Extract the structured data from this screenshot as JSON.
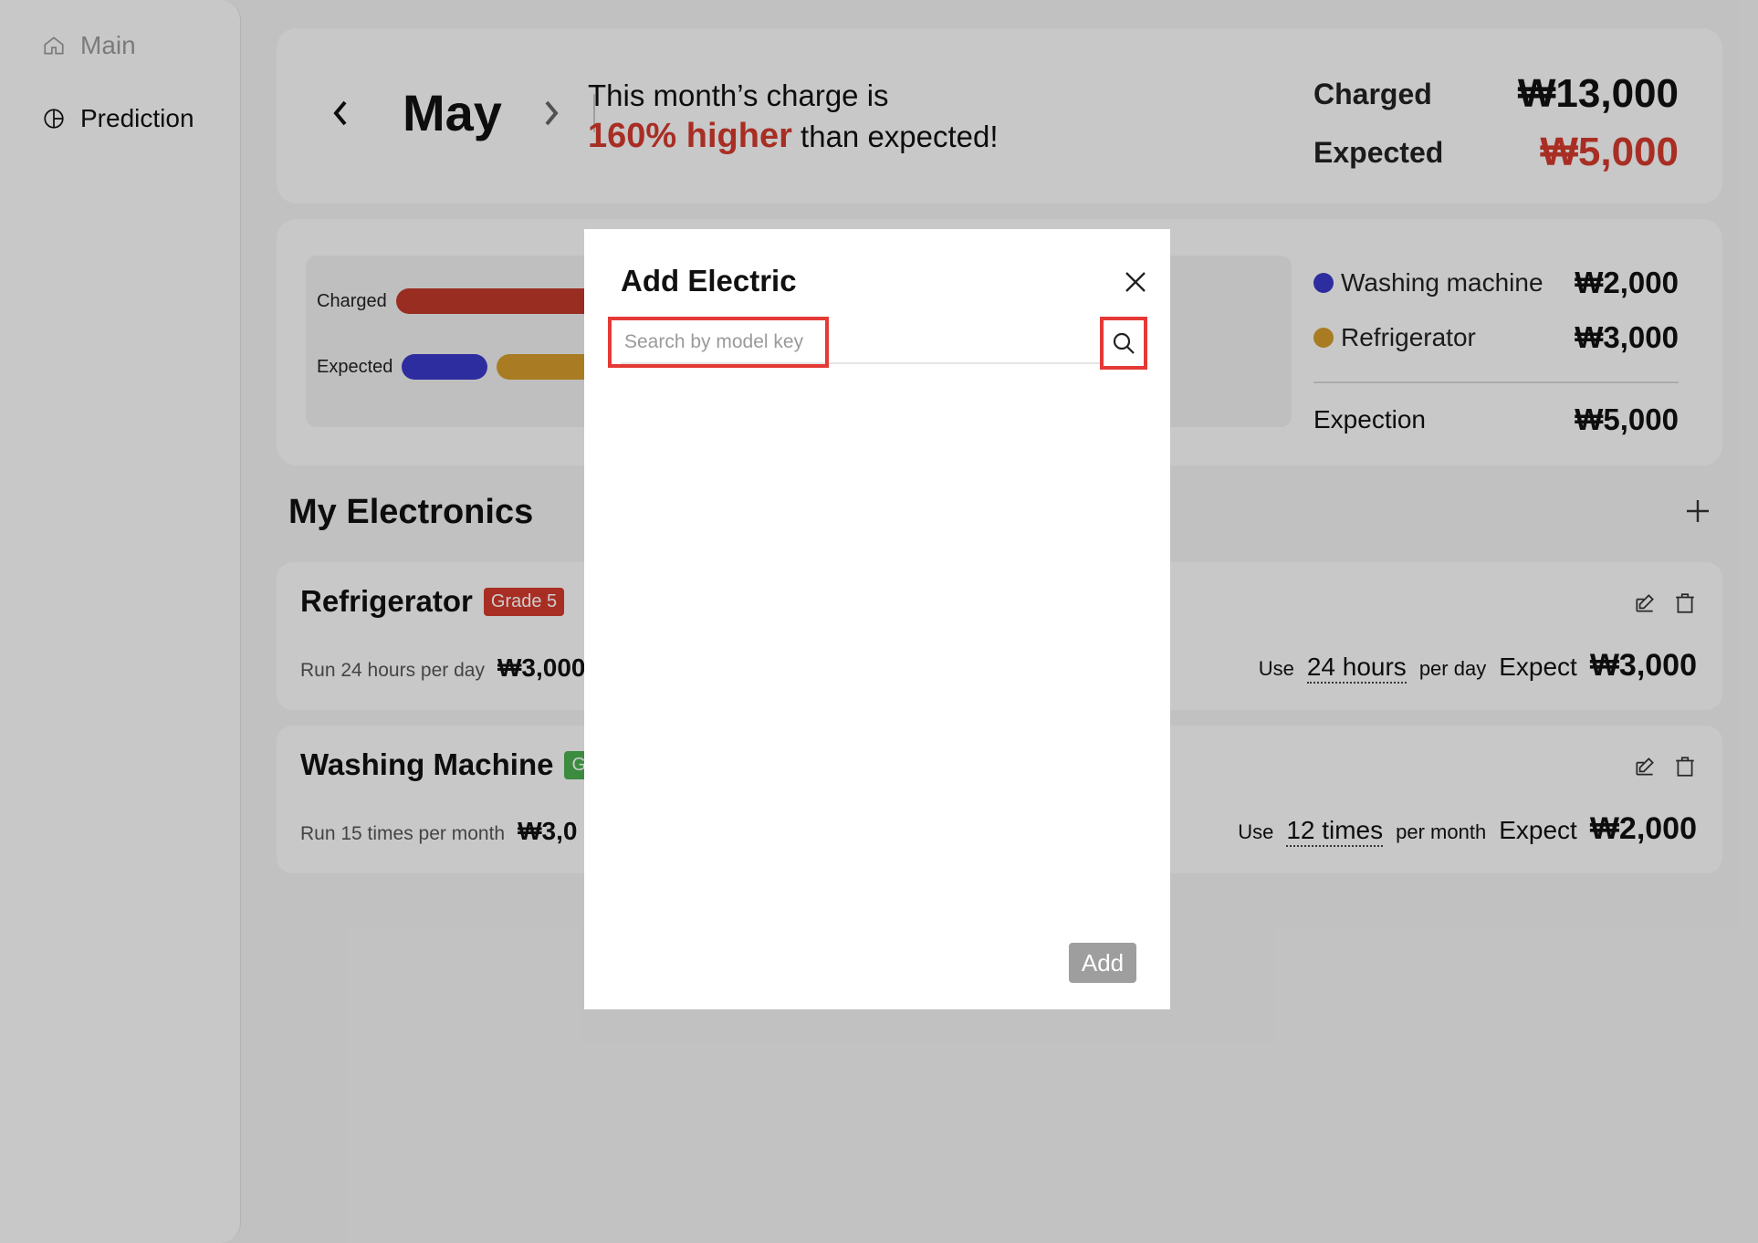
{
  "sidebar": {
    "items": [
      {
        "label": "Main",
        "icon": "home-icon"
      },
      {
        "label": "Prediction",
        "icon": "pie-chart-icon"
      }
    ]
  },
  "header": {
    "month": "May",
    "message_prefix": "This month’s charge is",
    "message_highlight": "160% higher",
    "message_suffix": " than expected!",
    "charged_label": "Charged",
    "charged_value": "₩13,000",
    "expected_label": "Expected",
    "expected_value": "₩5,000"
  },
  "chart": {
    "row_charged_label": "Charged",
    "row_expected_label": "Expected",
    "colors": {
      "charged": "#c0392b",
      "washing": "#3a39c7",
      "refrigerator": "#d49c2c"
    }
  },
  "legend": {
    "items": [
      {
        "name": "Washing machine",
        "value": "₩2,000",
        "color": "#3a39c7"
      },
      {
        "name": "Refrigerator",
        "value": "₩3,000",
        "color": "#d49c2c"
      }
    ],
    "total_label": "Expection",
    "total_value": "₩5,000"
  },
  "electronics": {
    "title": "My Electronics",
    "devices": [
      {
        "name": "Refrigerator",
        "grade": "Grade 5",
        "run_text": "Run 24 hours per day",
        "run_cost": "₩3,000",
        "use_label": "Use",
        "use_value": "24 hours",
        "use_unit": "per day",
        "expect_label": "Expect",
        "expect_value": "₩3,000"
      },
      {
        "name": "Washing Machine",
        "grade": "Gr",
        "run_text": "Run 15 times per month",
        "run_cost": "₩3,0",
        "use_label": "Use",
        "use_value": "12 times",
        "use_unit": "per month",
        "expect_label": "Expect",
        "expect_value": "₩2,000"
      }
    ]
  },
  "modal": {
    "title": "Add Electric",
    "search_placeholder": "Search by model key",
    "add_label": "Add"
  }
}
